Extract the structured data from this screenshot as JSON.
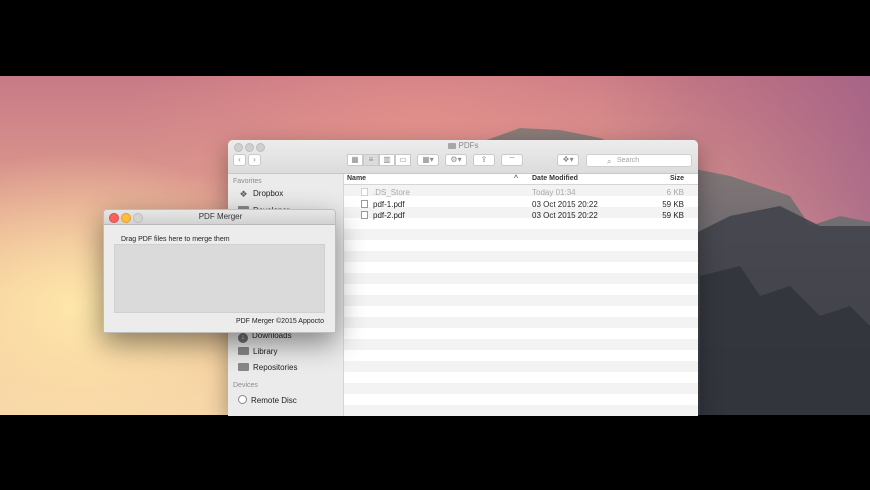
{
  "finder": {
    "title": "PDFs",
    "search_placeholder": "Search",
    "sidebar": {
      "favorites_header": "Favorites",
      "devices_header": "Devices",
      "items": [
        {
          "label": "Dropbox"
        },
        {
          "label": "Developer"
        },
        {
          "label": "Downloads"
        },
        {
          "label": "Library"
        },
        {
          "label": "Repositories"
        },
        {
          "label": "Remote Disc"
        }
      ]
    },
    "columns": {
      "name": "Name",
      "date": "Date Modified",
      "size": "Size"
    },
    "files": [
      {
        "name": ".DS_Store",
        "date": "Today 01:34",
        "size": "6 KB"
      },
      {
        "name": "pdf-1.pdf",
        "date": "03 Oct 2015 20:22",
        "size": "59 KB"
      },
      {
        "name": "pdf-2.pdf",
        "date": "03 Oct 2015 20:22",
        "size": "59 KB"
      }
    ]
  },
  "merger": {
    "title": "PDF Merger",
    "instruction": "Drag PDF files here to merge them",
    "footer": "PDF Merger ©2015 Appocto"
  },
  "colors": {
    "close": "#fc605c",
    "minimize": "#fdbc40",
    "zoom": "#d3d3d3"
  }
}
